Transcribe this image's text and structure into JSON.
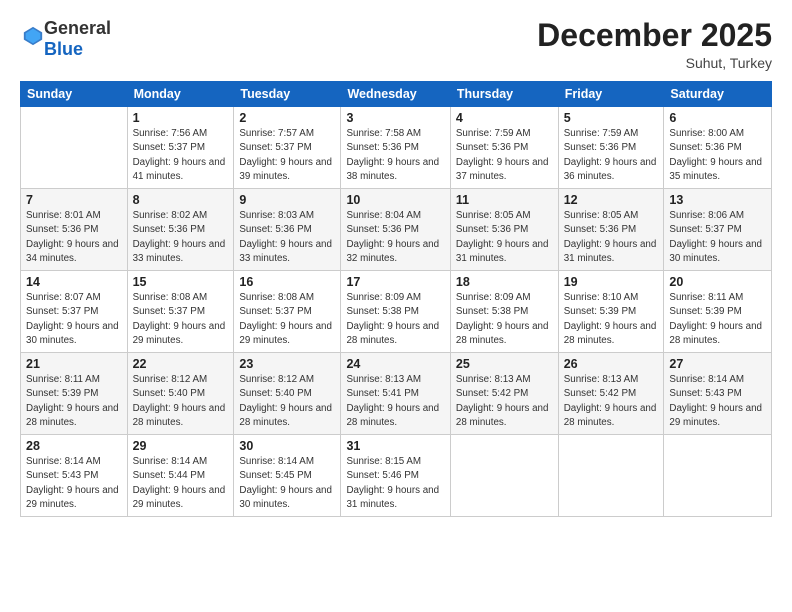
{
  "header": {
    "logo_general": "General",
    "logo_blue": "Blue",
    "month_title": "December 2025",
    "location": "Suhut, Turkey"
  },
  "days_of_week": [
    "Sunday",
    "Monday",
    "Tuesday",
    "Wednesday",
    "Thursday",
    "Friday",
    "Saturday"
  ],
  "weeks": [
    [
      {
        "num": "",
        "sunrise": "",
        "sunset": "",
        "daylight": ""
      },
      {
        "num": "1",
        "sunrise": "Sunrise: 7:56 AM",
        "sunset": "Sunset: 5:37 PM",
        "daylight": "Daylight: 9 hours and 41 minutes."
      },
      {
        "num": "2",
        "sunrise": "Sunrise: 7:57 AM",
        "sunset": "Sunset: 5:37 PM",
        "daylight": "Daylight: 9 hours and 39 minutes."
      },
      {
        "num": "3",
        "sunrise": "Sunrise: 7:58 AM",
        "sunset": "Sunset: 5:36 PM",
        "daylight": "Daylight: 9 hours and 38 minutes."
      },
      {
        "num": "4",
        "sunrise": "Sunrise: 7:59 AM",
        "sunset": "Sunset: 5:36 PM",
        "daylight": "Daylight: 9 hours and 37 minutes."
      },
      {
        "num": "5",
        "sunrise": "Sunrise: 7:59 AM",
        "sunset": "Sunset: 5:36 PM",
        "daylight": "Daylight: 9 hours and 36 minutes."
      },
      {
        "num": "6",
        "sunrise": "Sunrise: 8:00 AM",
        "sunset": "Sunset: 5:36 PM",
        "daylight": "Daylight: 9 hours and 35 minutes."
      }
    ],
    [
      {
        "num": "7",
        "sunrise": "Sunrise: 8:01 AM",
        "sunset": "Sunset: 5:36 PM",
        "daylight": "Daylight: 9 hours and 34 minutes."
      },
      {
        "num": "8",
        "sunrise": "Sunrise: 8:02 AM",
        "sunset": "Sunset: 5:36 PM",
        "daylight": "Daylight: 9 hours and 33 minutes."
      },
      {
        "num": "9",
        "sunrise": "Sunrise: 8:03 AM",
        "sunset": "Sunset: 5:36 PM",
        "daylight": "Daylight: 9 hours and 33 minutes."
      },
      {
        "num": "10",
        "sunrise": "Sunrise: 8:04 AM",
        "sunset": "Sunset: 5:36 PM",
        "daylight": "Daylight: 9 hours and 32 minutes."
      },
      {
        "num": "11",
        "sunrise": "Sunrise: 8:05 AM",
        "sunset": "Sunset: 5:36 PM",
        "daylight": "Daylight: 9 hours and 31 minutes."
      },
      {
        "num": "12",
        "sunrise": "Sunrise: 8:05 AM",
        "sunset": "Sunset: 5:36 PM",
        "daylight": "Daylight: 9 hours and 31 minutes."
      },
      {
        "num": "13",
        "sunrise": "Sunrise: 8:06 AM",
        "sunset": "Sunset: 5:37 PM",
        "daylight": "Daylight: 9 hours and 30 minutes."
      }
    ],
    [
      {
        "num": "14",
        "sunrise": "Sunrise: 8:07 AM",
        "sunset": "Sunset: 5:37 PM",
        "daylight": "Daylight: 9 hours and 30 minutes."
      },
      {
        "num": "15",
        "sunrise": "Sunrise: 8:08 AM",
        "sunset": "Sunset: 5:37 PM",
        "daylight": "Daylight: 9 hours and 29 minutes."
      },
      {
        "num": "16",
        "sunrise": "Sunrise: 8:08 AM",
        "sunset": "Sunset: 5:37 PM",
        "daylight": "Daylight: 9 hours and 29 minutes."
      },
      {
        "num": "17",
        "sunrise": "Sunrise: 8:09 AM",
        "sunset": "Sunset: 5:38 PM",
        "daylight": "Daylight: 9 hours and 28 minutes."
      },
      {
        "num": "18",
        "sunrise": "Sunrise: 8:09 AM",
        "sunset": "Sunset: 5:38 PM",
        "daylight": "Daylight: 9 hours and 28 minutes."
      },
      {
        "num": "19",
        "sunrise": "Sunrise: 8:10 AM",
        "sunset": "Sunset: 5:39 PM",
        "daylight": "Daylight: 9 hours and 28 minutes."
      },
      {
        "num": "20",
        "sunrise": "Sunrise: 8:11 AM",
        "sunset": "Sunset: 5:39 PM",
        "daylight": "Daylight: 9 hours and 28 minutes."
      }
    ],
    [
      {
        "num": "21",
        "sunrise": "Sunrise: 8:11 AM",
        "sunset": "Sunset: 5:39 PM",
        "daylight": "Daylight: 9 hours and 28 minutes."
      },
      {
        "num": "22",
        "sunrise": "Sunrise: 8:12 AM",
        "sunset": "Sunset: 5:40 PM",
        "daylight": "Daylight: 9 hours and 28 minutes."
      },
      {
        "num": "23",
        "sunrise": "Sunrise: 8:12 AM",
        "sunset": "Sunset: 5:40 PM",
        "daylight": "Daylight: 9 hours and 28 minutes."
      },
      {
        "num": "24",
        "sunrise": "Sunrise: 8:13 AM",
        "sunset": "Sunset: 5:41 PM",
        "daylight": "Daylight: 9 hours and 28 minutes."
      },
      {
        "num": "25",
        "sunrise": "Sunrise: 8:13 AM",
        "sunset": "Sunset: 5:42 PM",
        "daylight": "Daylight: 9 hours and 28 minutes."
      },
      {
        "num": "26",
        "sunrise": "Sunrise: 8:13 AM",
        "sunset": "Sunset: 5:42 PM",
        "daylight": "Daylight: 9 hours and 28 minutes."
      },
      {
        "num": "27",
        "sunrise": "Sunrise: 8:14 AM",
        "sunset": "Sunset: 5:43 PM",
        "daylight": "Daylight: 9 hours and 29 minutes."
      }
    ],
    [
      {
        "num": "28",
        "sunrise": "Sunrise: 8:14 AM",
        "sunset": "Sunset: 5:43 PM",
        "daylight": "Daylight: 9 hours and 29 minutes."
      },
      {
        "num": "29",
        "sunrise": "Sunrise: 8:14 AM",
        "sunset": "Sunset: 5:44 PM",
        "daylight": "Daylight: 9 hours and 29 minutes."
      },
      {
        "num": "30",
        "sunrise": "Sunrise: 8:14 AM",
        "sunset": "Sunset: 5:45 PM",
        "daylight": "Daylight: 9 hours and 30 minutes."
      },
      {
        "num": "31",
        "sunrise": "Sunrise: 8:15 AM",
        "sunset": "Sunset: 5:46 PM",
        "daylight": "Daylight: 9 hours and 31 minutes."
      },
      {
        "num": "",
        "sunrise": "",
        "sunset": "",
        "daylight": ""
      },
      {
        "num": "",
        "sunrise": "",
        "sunset": "",
        "daylight": ""
      },
      {
        "num": "",
        "sunrise": "",
        "sunset": "",
        "daylight": ""
      }
    ]
  ]
}
